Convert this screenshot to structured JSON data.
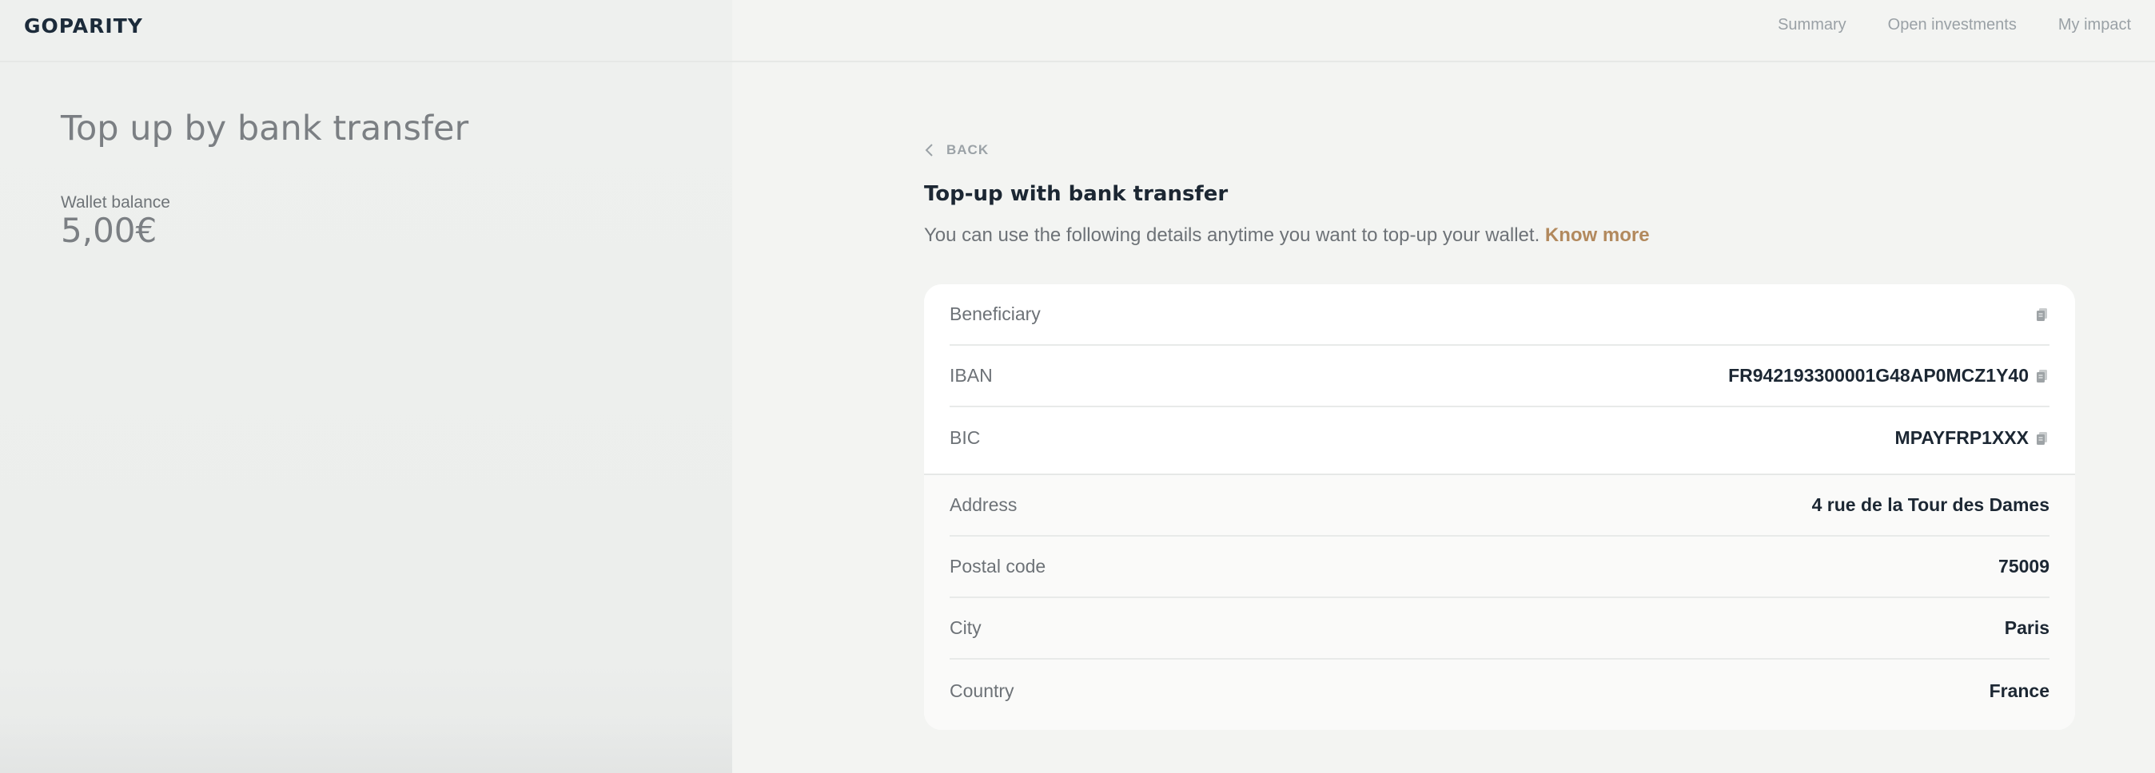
{
  "header": {
    "logo": "GOPARITY",
    "nav": [
      "Summary",
      "Open investments",
      "My impact"
    ]
  },
  "left": {
    "title": "Top up by bank transfer",
    "wallet_label": "Wallet balance",
    "wallet_value": "5,00€"
  },
  "main": {
    "back_label": "BACK",
    "title": "Top-up with bank transfer",
    "description": "You can use the following details anytime you want to top-up your wallet. ",
    "know_more": "Know more",
    "rows": [
      {
        "label": "Beneficiary",
        "value": "",
        "copy": true
      },
      {
        "label": "IBAN",
        "value": "FR942193300001G48AP0MCZ1Y40",
        "copy": true
      },
      {
        "label": "BIC",
        "value": "MPAYFRP1XXX",
        "copy": true
      },
      {
        "label": "Address",
        "value": "4 rue de la Tour des Dames",
        "copy": false
      },
      {
        "label": "Postal code",
        "value": "75009",
        "copy": false
      },
      {
        "label": "City",
        "value": "Paris",
        "copy": false
      },
      {
        "label": "Country",
        "value": "France",
        "copy": false
      }
    ]
  },
  "icons": {
    "back": "chevron-left-icon",
    "copy": "copy-icon"
  },
  "colors": {
    "accent": "#b2895d",
    "text_dark": "#1c2733",
    "text_muted": "#6d7277"
  }
}
